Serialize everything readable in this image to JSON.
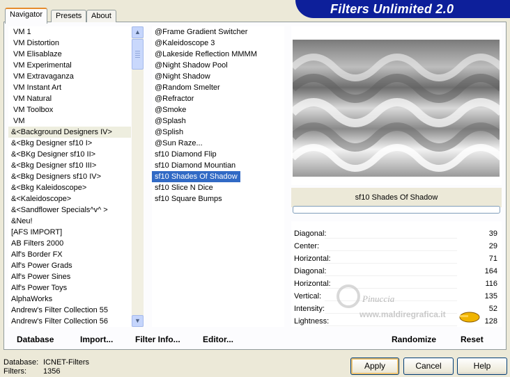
{
  "app_title": "Filters Unlimited 2.0",
  "tabs": [
    "Navigator",
    "Presets",
    "About"
  ],
  "categories": [
    "VM 1",
    "VM Distortion",
    "VM Elisablaze",
    "VM Experimental",
    "VM Extravaganza",
    "VM Instant Art",
    "VM Natural",
    "VM Toolbox",
    "VM",
    "&<Background Designers IV>",
    "&<Bkg Designer sf10 I>",
    "&<BKg Designer sf10 II>",
    "&<Bkg Designer sf10 III>",
    "&<Bkg Designers sf10 IV>",
    "&<Bkg Kaleidoscope>",
    "&<Kaleidoscope>",
    "&<Sandflower Specials^v^ >",
    "&Neu!",
    "[AFS IMPORT]",
    "AB Filters 2000",
    "Alf's Border FX",
    "Alf's Power Grads",
    "Alf's Power Sines",
    "Alf's Power Toys",
    "AlphaWorks",
    "Andrew's Filter Collection 55",
    "Andrew's Filter Collection 56"
  ],
  "filters": [
    "@Frame Gradient Switcher",
    "@Kaleidoscope 3",
    "@Lakeside Reflection MMMM",
    "@Night Shadow Pool",
    "@Night Shadow",
    "@Random Smelter",
    "@Refractor",
    "@Smoke",
    "@Splash",
    "@Splish",
    "@Sun Raze...",
    "sf10 Diamond Flip",
    "sf10 Diamond Mountian",
    "sf10 Shades Of Shadow",
    "sf10 Slice N Dice",
    "sf10 Square Bumps"
  ],
  "selected_filter": "sf10 Shades Of Shadow",
  "params": [
    {
      "label": "Diagonal:",
      "value": "39"
    },
    {
      "label": "Center:",
      "value": "29"
    },
    {
      "label": "Horizontal:",
      "value": "71"
    },
    {
      "label": "Diagonal:",
      "value": "164"
    },
    {
      "label": "Horizontal:",
      "value": "116"
    },
    {
      "label": "Vertical:",
      "value": "135"
    },
    {
      "label": "Intensity:",
      "value": "52"
    },
    {
      "label": "Lightness:",
      "value": "128"
    }
  ],
  "bottom_buttons": {
    "database": "Database",
    "import": "Import...",
    "filter_info": "Filter Info...",
    "editor": "Editor...",
    "randomize": "Randomize",
    "reset": "Reset"
  },
  "status": {
    "database_label": "Database:",
    "database_value": "ICNET-Filters",
    "filters_label": "Filters:",
    "filters_value": "1356"
  },
  "dialog_buttons": {
    "apply": "Apply",
    "cancel": "Cancel",
    "help": "Help"
  },
  "watermark": {
    "line1": "Pinuccia",
    "line2": "www.maldiregrafica.it"
  },
  "colors": {
    "banner": "#0d1f9a",
    "selection": "#316ac5",
    "tab_accent": "#e68b2c"
  }
}
